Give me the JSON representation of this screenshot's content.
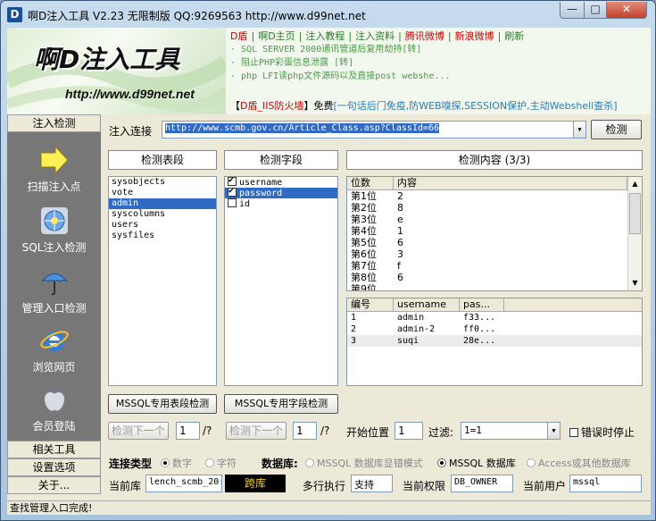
{
  "window": {
    "title": "啊D注入工具 V2.23 无限制版 QQ:9269563 http://www.d99net.net",
    "icon_letter": "D",
    "minimize": "—",
    "maximize": "□",
    "close": "✕"
  },
  "banner": {
    "logo_title": "啊D注入工具",
    "logo_url": "http://www.d99net.net",
    "nav": [
      {
        "label": "D盾",
        "color": "#cc0000"
      },
      {
        "label": "|",
        "color": "#2a7a2a"
      },
      {
        "label": "啊D主页",
        "color": "#2a7a2a"
      },
      {
        "label": "|",
        "color": "#2a7a2a"
      },
      {
        "label": "注入教程",
        "color": "#2a7a2a"
      },
      {
        "label": "|",
        "color": "#2a7a2a"
      },
      {
        "label": "注入资料",
        "color": "#2a7a2a"
      },
      {
        "label": "|",
        "color": "#2a7a2a"
      },
      {
        "label": "腾讯微博",
        "color": "#cc0000"
      },
      {
        "label": "|",
        "color": "#2a7a2a"
      },
      {
        "label": "新浪微博",
        "color": "#cc0000"
      },
      {
        "label": "|",
        "color": "#2a7a2a"
      },
      {
        "label": "刷新",
        "color": "#2a7a2a"
      }
    ],
    "news": [
      "· SQL SERVER 2000通讯管道后复用劫持[转]",
      "· 阻止PHP彩蛋信息泄露 [转]",
      "· php LFI读php文件源码以及直接post webshe..."
    ],
    "promo": {
      "prefix": "【",
      "product": "D盾_IIS防火墙",
      "mid": "】免费",
      "desc": "[一句话后门免疫,防WEB嗅探,SESSION保护,主动Webshell查杀]"
    }
  },
  "sidebar": {
    "top_tab": "注入检测",
    "items": [
      {
        "label": "扫描注入点",
        "icon": "arrow-icon"
      },
      {
        "label": "SQL注入检测",
        "icon": "globe-icon"
      },
      {
        "label": "管理入口检测",
        "icon": "umbrella-icon"
      },
      {
        "label": "浏览网页",
        "icon": "ie-icon"
      },
      {
        "label": "会员登陆",
        "icon": "apple-icon"
      }
    ],
    "bottom_tabs": [
      "相关工具",
      "设置选项",
      "关于..."
    ]
  },
  "main": {
    "inject_label": "注入连接",
    "inject_url": "http://www.scmb.gov.cn/Article_Class.asp?ClassId=66",
    "detect_button": "检测",
    "tables_header": "检测表段",
    "tables": [
      "sysobjects",
      "vote",
      "admin",
      "syscolumns",
      "users",
      "sysfiles"
    ],
    "tables_selected": 2,
    "fields_header": "检测字段",
    "fields": [
      {
        "name": "username",
        "checked": true,
        "selected": false
      },
      {
        "name": "password",
        "checked": true,
        "selected": true
      },
      {
        "name": "id",
        "checked": false,
        "selected": false
      }
    ],
    "content_header": "检测内容 (3/3)",
    "position_grid": {
      "columns": [
        "位数",
        "内容"
      ],
      "rows": [
        [
          "第1位",
          "2"
        ],
        [
          "第2位",
          "8"
        ],
        [
          "第3位",
          "e"
        ],
        [
          "第4位",
          "1"
        ],
        [
          "第5位",
          "6"
        ],
        [
          "第6位",
          "3"
        ],
        [
          "第7位",
          "f"
        ],
        [
          "第8位",
          "6"
        ],
        [
          "第9位",
          ""
        ]
      ]
    },
    "results_grid": {
      "columns": [
        "编号",
        "username",
        "pas..."
      ],
      "rows": [
        [
          "1",
          "admin",
          "f33..."
        ],
        [
          "2",
          "admin-2",
          "ff0..."
        ],
        [
          "3",
          "suqi",
          "28e..."
        ]
      ],
      "selected": 2
    },
    "mssql_table_btn": "MSSQL专用表段检测",
    "mssql_field_btn": "MSSQL专用字段检测",
    "next1_btn": "检测下一个",
    "next1_value": "1",
    "next1_suffix": "/?",
    "next2_btn": "检测下一个",
    "next2_value": "1",
    "next2_suffix": "/?",
    "start_label": "开始位置",
    "start_value": "1",
    "filter_label": "过滤:",
    "filter_value": "1=1",
    "stop_on_error": "错误时停止",
    "conn_type_label": "连接类型",
    "conn_types": [
      "数字",
      "字符"
    ],
    "db_label": "数据库:",
    "db_options": [
      "MSSQL 数据库显错模式",
      "MSSQL 数据库",
      "Access或其他数据库"
    ],
    "db_selected": 1,
    "current_db_label": "当前库",
    "current_db_value": "lench_scmb_20:",
    "cross_db": "跨库",
    "multi_exec_label": "多行执行",
    "multi_exec_value": "支持",
    "perm_label": "当前权限",
    "perm_value": "DB_OWNER",
    "user_label": "当前用户",
    "user_value": "mssql"
  },
  "status": "查找管理入口完成!"
}
